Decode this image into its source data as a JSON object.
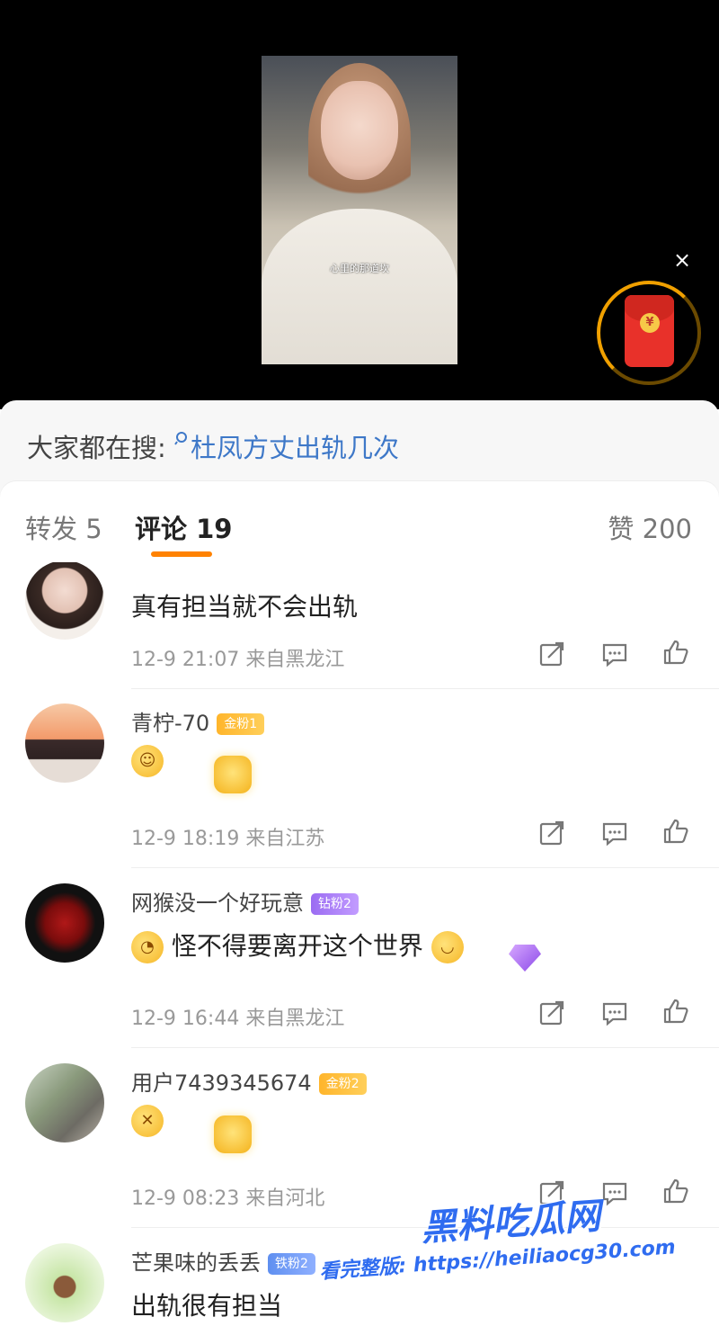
{
  "video": {
    "caption": "心里的那道坎",
    "close_symbol": "×",
    "redpacket_symbol": "¥"
  },
  "search_hint": {
    "prefix": "大家都在搜: ",
    "keyword": "杜凤方丈出轨几次"
  },
  "tabs": {
    "repost": "转发 5",
    "comments": "评论 19",
    "likes": "赞 200"
  },
  "comments": [
    {
      "name": "",
      "text": "真有担当就不会出轨",
      "meta": "12-9 21:07 来自黑龙江",
      "avatar_color": "#e9d8cf"
    },
    {
      "name": "青柠-70",
      "badge": "金粉1",
      "text": "",
      "meta": "12-9 18:19 来自江苏",
      "avatar_color": "#f0b48a"
    },
    {
      "name": "网猴没一个好玩意",
      "badge": "钻粉2",
      "text": "怪不得要离开这个世界",
      "meta": "12-9 16:44 来自黑龙江",
      "avatar_color": "#111111"
    },
    {
      "name": "用户7439345674",
      "badge": "金粉2",
      "text": "",
      "meta": "12-9 08:23 来自河北",
      "avatar_color": "#8a9a7c"
    },
    {
      "name": "芒果味的丢丢",
      "badge": "铁粉2",
      "text": "出轨很有担当",
      "meta": "",
      "avatar_color": "#c8e6a8"
    }
  ],
  "watermark": {
    "logo": "黑料吃瓜网",
    "url": "看完整版: https://heiliaocg30.com"
  },
  "colors": {
    "accent": "#ff8200",
    "link": "#3e78c8",
    "gold_badge": "#ffb52b",
    "diamond_badge": "#9b6cf2",
    "iron_badge": "#5f8ff0"
  }
}
